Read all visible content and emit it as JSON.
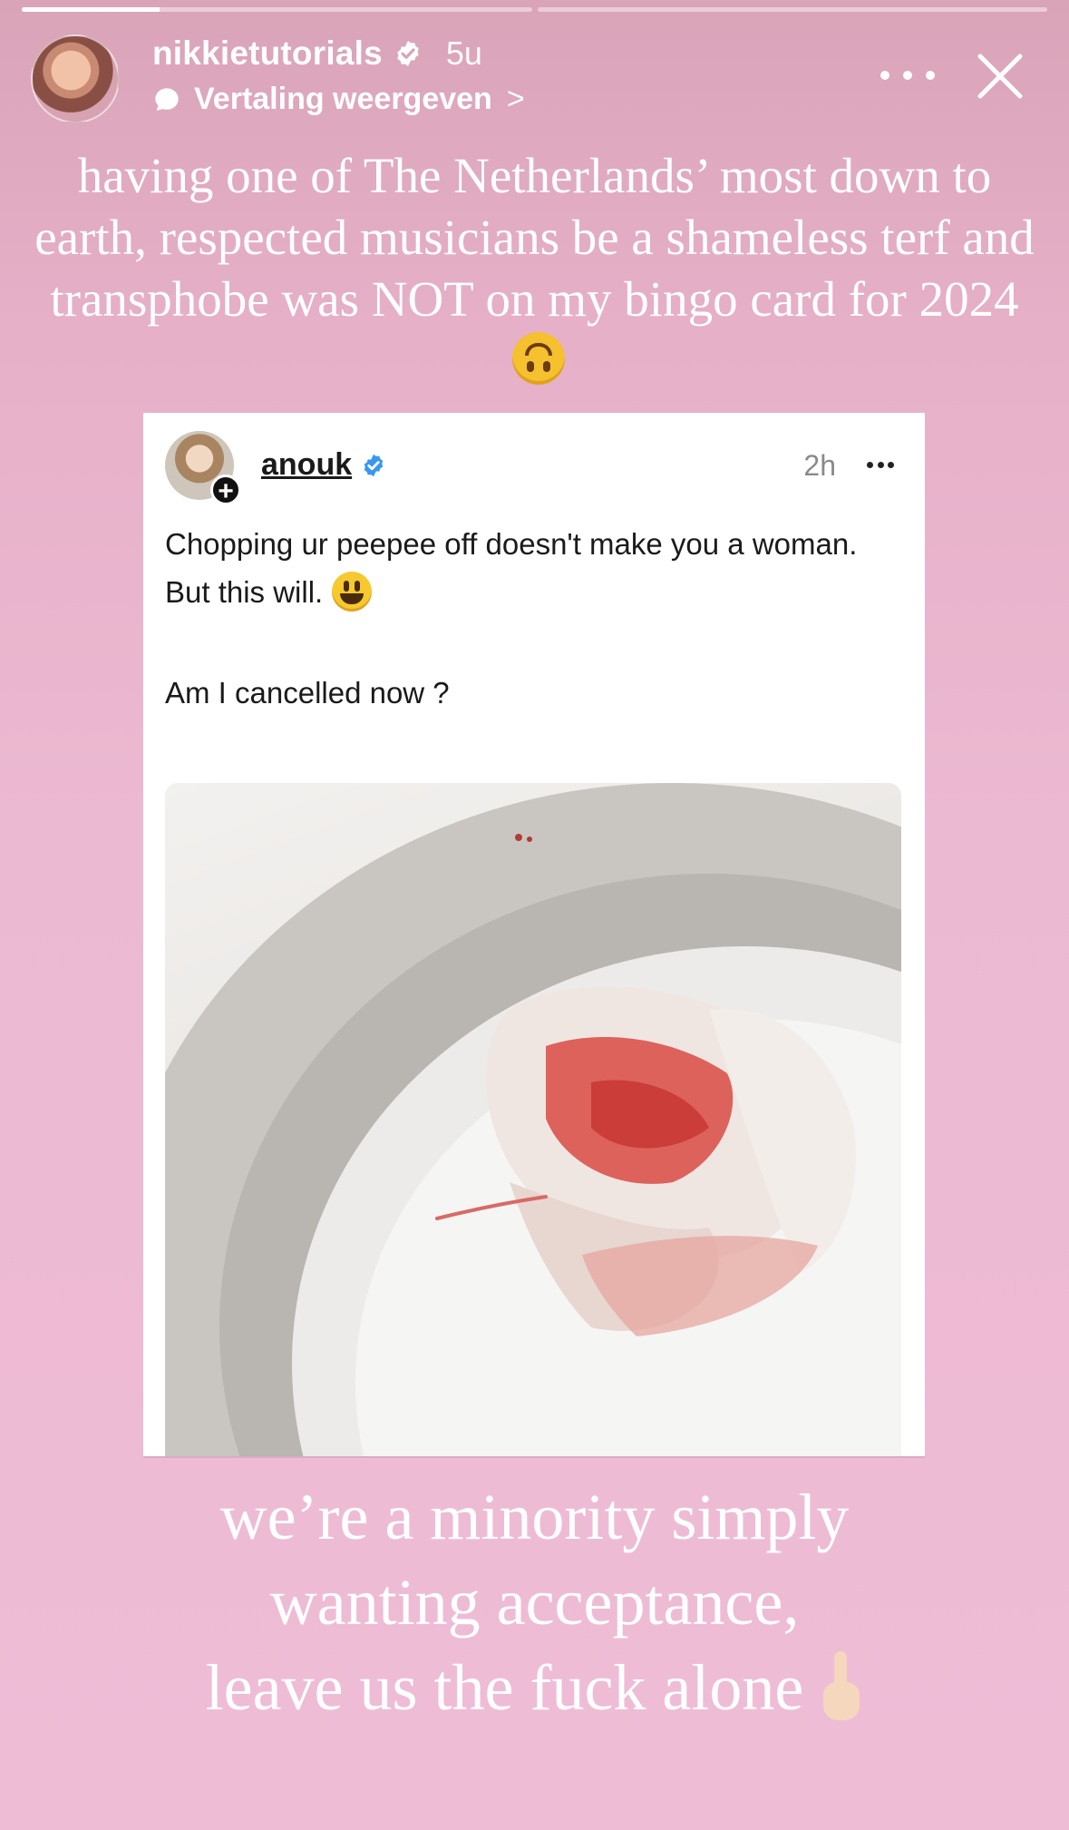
{
  "story": {
    "progress": [
      0.27,
      0
    ]
  },
  "header": {
    "username": "nikkietutorials",
    "time": "5u",
    "translate_label": "Vertaling weergeven",
    "chevron": ">"
  },
  "caption_top": "having one of The Netherlands’ most down to earth, respected musicians be a shameless terf and transphobe was NOT on my bingo card for 2024",
  "post": {
    "username": "anouk",
    "time": "2h",
    "add_symbol": "+",
    "lines": [
      "Chopping ur peepee off doesn't make you a woman.",
      "But this will."
    ],
    "question": "Am I cancelled now ?"
  },
  "caption_bottom": {
    "line1": "we’re a minority simply",
    "line2": "wanting acceptance,",
    "line3": "leave us the fuck alone"
  },
  "icons": {
    "verified": "verified-badge-icon",
    "translate": "speech-bubble-icon",
    "more": "more-options-icon",
    "close": "close-icon",
    "emoji_upside": "upside-down-face-emoji-icon",
    "emoji_smiley": "smiley-emoji-icon",
    "emoji_finger": "middle-finger-emoji-icon"
  },
  "colors": {
    "background": "#ecb9d2",
    "verified_blue": "#3897f0"
  }
}
